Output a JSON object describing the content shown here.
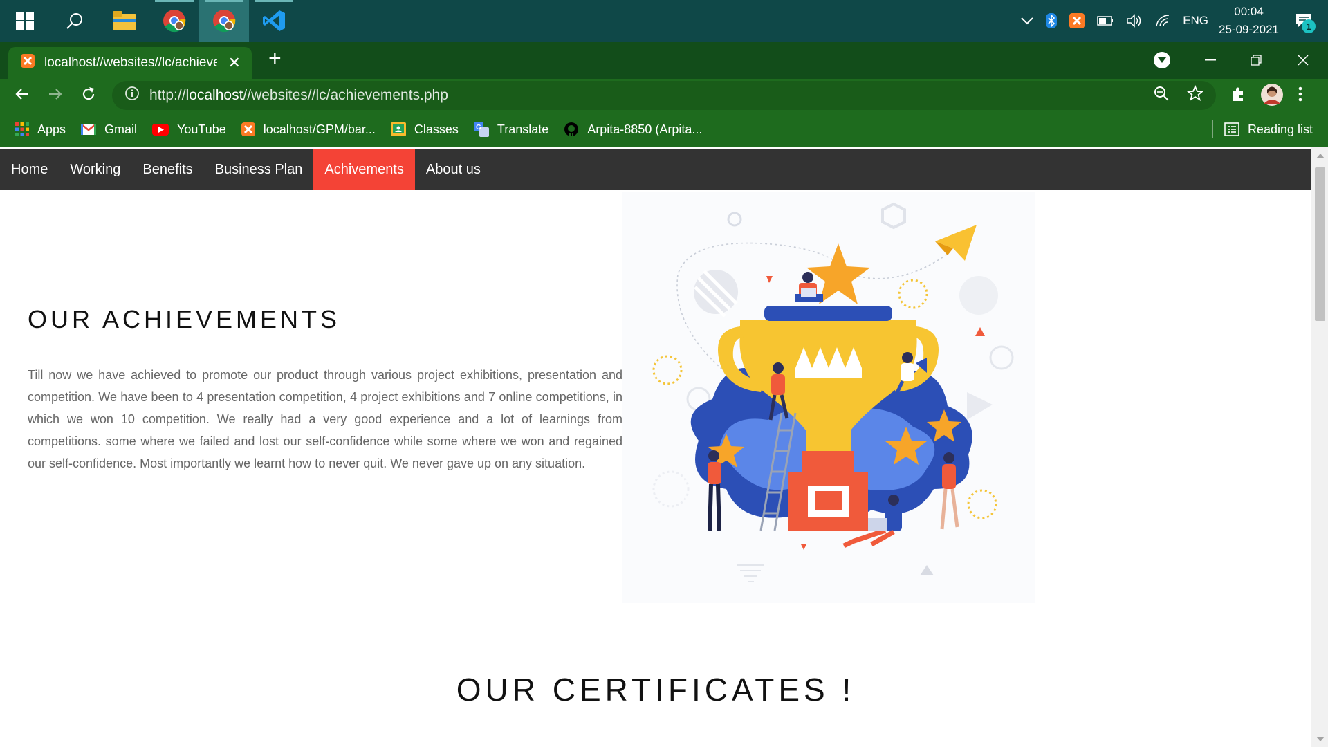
{
  "taskbar": {
    "apps": [
      "start-icon",
      "search-icon",
      "file-explorer-icon",
      "chrome-icon",
      "chrome-profile-icon",
      "vscode-icon"
    ],
    "tray": {
      "language": "ENG",
      "time": "00:04",
      "date": "25-09-2021",
      "notification_count": "1"
    }
  },
  "browser": {
    "tab_title": "localhost//websites//lc/achievements.php",
    "url_scheme": "http://",
    "url_host": "localhost",
    "url_path": "//websites//lc/achievements.php",
    "bookmarks": [
      {
        "label": "Apps",
        "icon": "apps-grid-icon"
      },
      {
        "label": "Gmail",
        "icon": "gmail-icon"
      },
      {
        "label": "YouTube",
        "icon": "youtube-icon"
      },
      {
        "label": "localhost/GPM/bar...",
        "icon": "xampp-icon"
      },
      {
        "label": "Classes",
        "icon": "classroom-icon"
      },
      {
        "label": "Translate",
        "icon": "translate-icon"
      },
      {
        "label": "Arpita-8850 (Arpita...",
        "icon": "github-icon"
      }
    ],
    "reading_list": "Reading list"
  },
  "site": {
    "nav": [
      "Home",
      "Working",
      "Benefits",
      "Business Plan",
      "Achivements",
      "About us"
    ],
    "active_nav": "Achivements",
    "achievements_title": "OUR ACHIEVEMENTS",
    "achievements_text": "Till now we have achieved to promote our product through various project exhibitions, presentation and competition. We have been to 4 presentation competition, 4 project exhibitions and 7 online competitions, in which we won 10 competition. We really had a very good experience and a lot of learnings from competitions. some where we failed and lost our self-confidence while some where we won and regained our self-confidence. Most importantly we learnt how to never quit. We never gave up on any situation.",
    "certificates_title": "OUR CERTIFICATES !",
    "accent_color": "#f44336",
    "nav_bg": "#333333"
  }
}
